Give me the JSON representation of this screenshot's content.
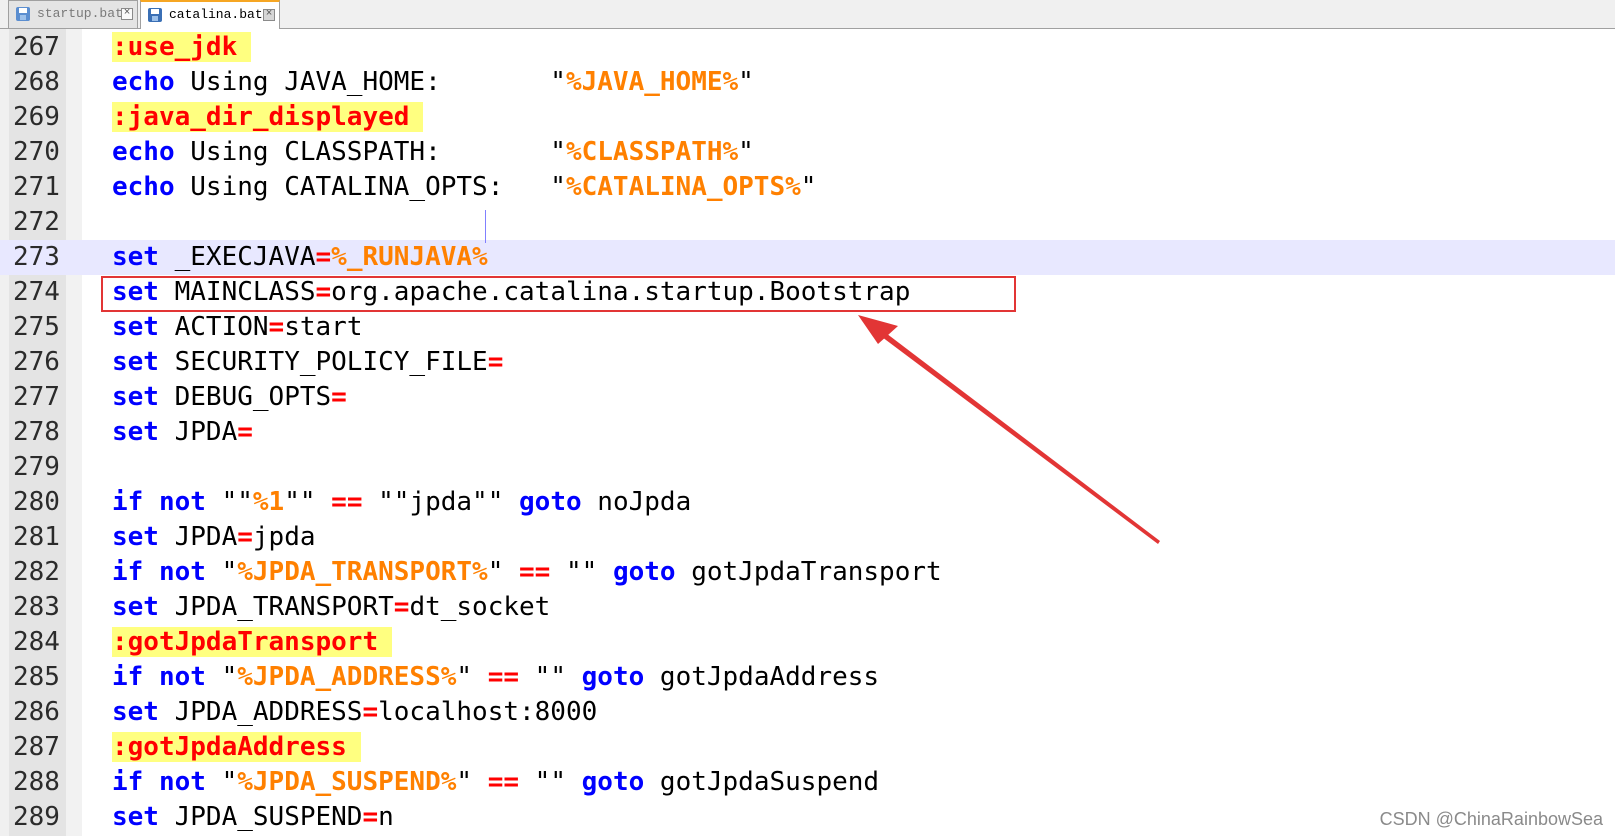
{
  "tabs": [
    {
      "label": "startup.bat",
      "active": false,
      "icon": "save-disk-icon"
    },
    {
      "label": "catalina.bat",
      "active": true,
      "icon": "save-disk-icon"
    }
  ],
  "lines": [
    {
      "num": "267",
      "tokens": [
        [
          "lbl",
          ":use_jdk"
        ]
      ]
    },
    {
      "num": "268",
      "tokens": [
        [
          "kw",
          "echo"
        ],
        [
          "t",
          " Using JAVA_HOME:       \""
        ],
        [
          "var",
          "%JAVA_HOME%"
        ],
        [
          "t",
          "\""
        ]
      ]
    },
    {
      "num": "269",
      "tokens": [
        [
          "lbl",
          ":java_dir_displayed"
        ]
      ]
    },
    {
      "num": "270",
      "tokens": [
        [
          "kw",
          "echo"
        ],
        [
          "t",
          " Using CLASSPATH:       \""
        ],
        [
          "var",
          "%CLASSPATH%"
        ],
        [
          "t",
          "\""
        ]
      ]
    },
    {
      "num": "271",
      "tokens": [
        [
          "kw",
          "echo"
        ],
        [
          "t",
          " Using CATALINA_OPTS:   \""
        ],
        [
          "var",
          "%CATALINA_OPTS%"
        ],
        [
          "t",
          "\""
        ]
      ]
    },
    {
      "num": "272",
      "tokens": []
    },
    {
      "num": "273",
      "current": true,
      "tokens": [
        [
          "kw",
          "set"
        ],
        [
          "t",
          " _EXECJAVA"
        ],
        [
          "op",
          "="
        ],
        [
          "var",
          "%_RUNJAVA%"
        ]
      ]
    },
    {
      "num": "274",
      "tokens": [
        [
          "kw",
          "set"
        ],
        [
          "t",
          " MAINCLASS"
        ],
        [
          "op",
          "="
        ],
        [
          "t",
          "org.apache.catalina.startup.Bootstrap"
        ]
      ]
    },
    {
      "num": "275",
      "tokens": [
        [
          "kw",
          "set"
        ],
        [
          "t",
          " ACTION"
        ],
        [
          "op",
          "="
        ],
        [
          "t",
          "start"
        ]
      ]
    },
    {
      "num": "276",
      "tokens": [
        [
          "kw",
          "set"
        ],
        [
          "t",
          " SECURITY_POLICY_FILE"
        ],
        [
          "op",
          "="
        ]
      ]
    },
    {
      "num": "277",
      "tokens": [
        [
          "kw",
          "set"
        ],
        [
          "t",
          " DEBUG_OPTS"
        ],
        [
          "op",
          "="
        ]
      ]
    },
    {
      "num": "278",
      "tokens": [
        [
          "kw",
          "set"
        ],
        [
          "t",
          " JPDA"
        ],
        [
          "op",
          "="
        ]
      ]
    },
    {
      "num": "279",
      "tokens": []
    },
    {
      "num": "280",
      "tokens": [
        [
          "kw",
          "if not"
        ],
        [
          "t",
          " \"\""
        ],
        [
          "var",
          "%1"
        ],
        [
          "t",
          "\"\" "
        ],
        [
          "op",
          "=="
        ],
        [
          "t",
          " \"\"jpda\"\" "
        ],
        [
          "kw",
          "goto"
        ],
        [
          "t",
          " noJpda"
        ]
      ]
    },
    {
      "num": "281",
      "tokens": [
        [
          "kw",
          "set"
        ],
        [
          "t",
          " JPDA"
        ],
        [
          "op",
          "="
        ],
        [
          "t",
          "jpda"
        ]
      ]
    },
    {
      "num": "282",
      "tokens": [
        [
          "kw",
          "if not"
        ],
        [
          "t",
          " \""
        ],
        [
          "var",
          "%JPDA_TRANSPORT%"
        ],
        [
          "t",
          "\" "
        ],
        [
          "op",
          "=="
        ],
        [
          "t",
          " \"\" "
        ],
        [
          "kw",
          "goto"
        ],
        [
          "t",
          " gotJpdaTransport"
        ]
      ]
    },
    {
      "num": "283",
      "tokens": [
        [
          "kw",
          "set"
        ],
        [
          "t",
          " JPDA_TRANSPORT"
        ],
        [
          "op",
          "="
        ],
        [
          "t",
          "dt_socket"
        ]
      ]
    },
    {
      "num": "284",
      "tokens": [
        [
          "lbl",
          ":gotJpdaTransport"
        ]
      ]
    },
    {
      "num": "285",
      "tokens": [
        [
          "kw",
          "if not"
        ],
        [
          "t",
          " \""
        ],
        [
          "var",
          "%JPDA_ADDRESS%"
        ],
        [
          "t",
          "\" "
        ],
        [
          "op",
          "=="
        ],
        [
          "t",
          " \"\" "
        ],
        [
          "kw",
          "goto"
        ],
        [
          "t",
          " gotJpdaAddress"
        ]
      ]
    },
    {
      "num": "286",
      "tokens": [
        [
          "kw",
          "set"
        ],
        [
          "t",
          " JPDA_ADDRESS"
        ],
        [
          "op",
          "="
        ],
        [
          "t",
          "localhost:8000"
        ]
      ]
    },
    {
      "num": "287",
      "tokens": [
        [
          "lbl",
          ":gotJpdaAddress"
        ]
      ]
    },
    {
      "num": "288",
      "tokens": [
        [
          "kw",
          "if not"
        ],
        [
          "t",
          " \""
        ],
        [
          "var",
          "%JPDA_SUSPEND%"
        ],
        [
          "t",
          "\" "
        ],
        [
          "op",
          "=="
        ],
        [
          "t",
          " \"\" "
        ],
        [
          "kw",
          "goto"
        ],
        [
          "t",
          " gotJpdaSuspend"
        ]
      ]
    },
    {
      "num": "289",
      "tokens": [
        [
          "kw",
          "set"
        ],
        [
          "t",
          " JPDA_SUSPEND"
        ],
        [
          "op",
          "="
        ],
        [
          "t",
          "n"
        ]
      ]
    }
  ],
  "annotation": {
    "highlighted_line": "274",
    "box_color": "#e23535",
    "arrow_color": "#e23535"
  },
  "watermark": "CSDN @ChinaRainbowSea",
  "colors": {
    "keyword": "#0000ff",
    "variable": "#ff8000",
    "operator": "#ff0000",
    "label_bg": "#ffff80",
    "current_line": "#e8e8ff"
  }
}
